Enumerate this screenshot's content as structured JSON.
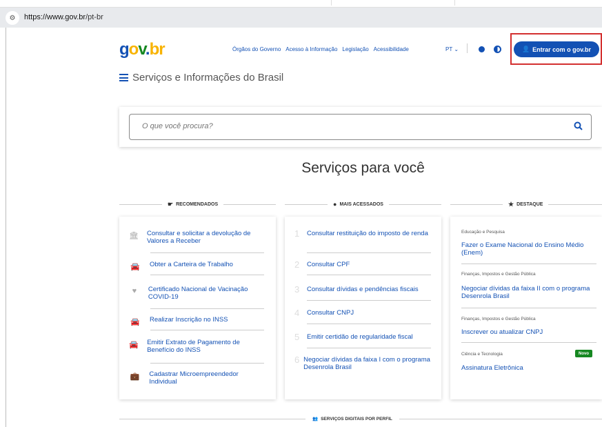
{
  "browser": {
    "url_host": "https://www.gov.br",
    "url_path": "/pt-br",
    "site_info_icon": "tune-icon"
  },
  "header": {
    "logo": "gov.br",
    "nav": [
      "Órgãos do Governo",
      "Acesso à Informação",
      "Legislação",
      "Acessibilidade"
    ],
    "language": "PT",
    "login_label": "Entrar com o gov.br",
    "menu_title": "Serviços e Informações do Brasil"
  },
  "search": {
    "placeholder": "O que você procura?"
  },
  "services_title": "Serviços para você",
  "columns": {
    "recomendados": {
      "title": "RECOMENDADOS",
      "items": [
        "Consultar e solicitar a devolução de Valores a Receber",
        "Obter a Carteira de Trabalho",
        "Certificado Nacional de Vacinação COVID-19",
        "Realizar Inscrição no INSS",
        "Emitir Extrato de Pagamento de Benefício do INSS",
        "Cadastrar Microempreendedor Individual"
      ]
    },
    "mais_acessados": {
      "title": "MAIS ACESSADOS",
      "numbers": [
        "1",
        "2",
        "3",
        "4",
        "5",
        "6"
      ],
      "items": [
        "Consultar restituição do imposto de renda",
        "Consultar CPF",
        "Consultar dívidas e pendências fiscais",
        "Consultar CNPJ",
        "Emitir certidão de regularidade fiscal",
        "Negociar dívidas da faixa I com o programa Desenrola Brasil"
      ]
    },
    "destaque": {
      "title": "DESTAQUE",
      "items": [
        {
          "category": "Educação e Pesquisa",
          "title": "Fazer o Exame Nacional do Ensino Médio (Enem)"
        },
        {
          "category": "Finanças, Impostos e Gestão Pública",
          "title": "Negociar dívidas da faixa II com o programa Desenrola Brasil"
        },
        {
          "category": "Finanças, Impostos e Gestão Pública",
          "title": "Inscrever ou atualizar CNPJ"
        },
        {
          "category": "Ciência e Tecnologia",
          "title": "Assinatura Eletrônica",
          "badge": "Novo"
        }
      ]
    }
  },
  "bottom_section_title": "SERVIÇOS DIGITAIS POR PERFIL",
  "colors": {
    "primary": "#1351b4",
    "yellow": "#f8b300",
    "green": "#168821",
    "highlight_outline": "#d32f2f"
  }
}
